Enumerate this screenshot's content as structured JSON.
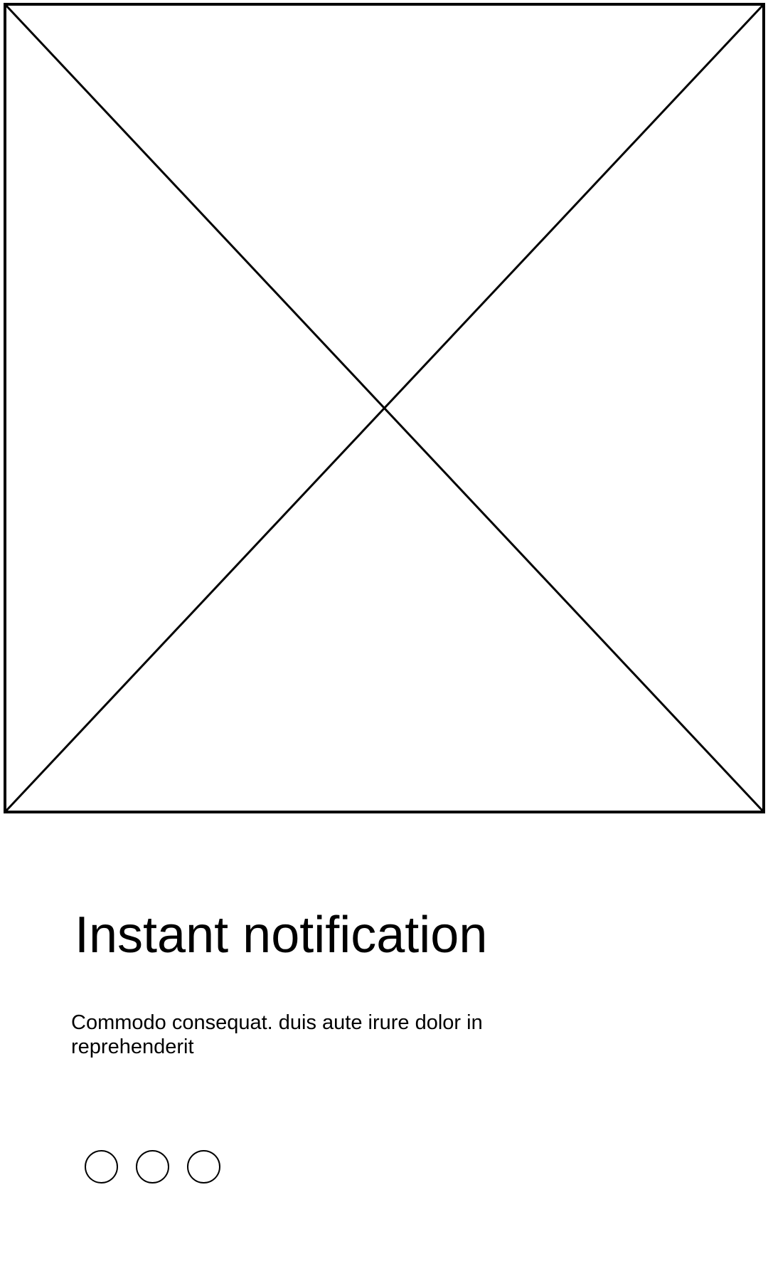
{
  "image_placeholder": {
    "icon": "image-placeholder-x"
  },
  "content": {
    "title": "Instant notification",
    "description": "Commodo consequat. duis aute irure dolor in reprehenderit"
  },
  "pager": {
    "dots": 3
  },
  "colors": {
    "background": "#ffffff",
    "foreground": "#000000"
  }
}
